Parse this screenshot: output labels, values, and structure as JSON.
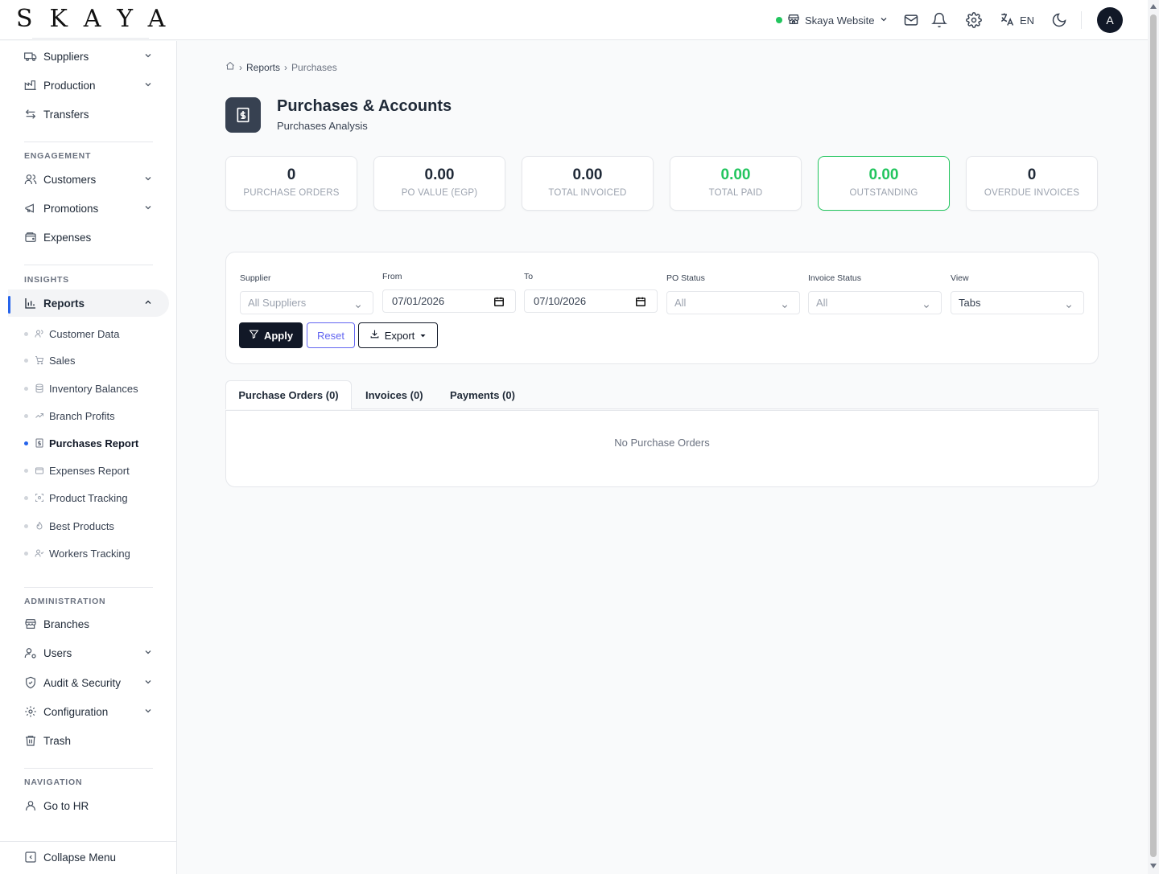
{
  "header": {
    "logo": "SKAYA",
    "store": "Skaya Website",
    "language": "EN",
    "avatar_initial": "A"
  },
  "sidebar": {
    "top_items": [
      {
        "label": "Suppliers"
      },
      {
        "label": "Production"
      },
      {
        "label": "Transfers"
      }
    ],
    "sections": {
      "engagement": "ENGAGEMENT",
      "insights": "INSIGHTS",
      "administration": "ADMINISTRATION",
      "navigation": "NAVIGATION"
    },
    "engagement_items": [
      {
        "label": "Customers"
      },
      {
        "label": "Promotions"
      },
      {
        "label": "Expenses"
      }
    ],
    "reports_label": "Reports",
    "report_subitems": [
      {
        "label": "Customer Data"
      },
      {
        "label": "Sales"
      },
      {
        "label": "Inventory Balances"
      },
      {
        "label": "Branch Profits"
      },
      {
        "label": "Purchases Report"
      },
      {
        "label": "Expenses Report"
      },
      {
        "label": "Product Tracking"
      },
      {
        "label": "Best Products"
      },
      {
        "label": "Workers Tracking"
      }
    ],
    "admin_items": [
      {
        "label": "Branches"
      },
      {
        "label": "Users"
      },
      {
        "label": "Audit & Security"
      },
      {
        "label": "Configuration"
      },
      {
        "label": "Trash"
      }
    ],
    "nav_items": [
      {
        "label": "Go to HR"
      }
    ],
    "collapse_label": "Collapse Menu"
  },
  "breadcrumb": {
    "parent": "Reports",
    "current": "Purchases"
  },
  "page": {
    "title": "Purchases & Accounts",
    "subtitle": "Purchases Analysis"
  },
  "stats": [
    {
      "value": "0",
      "label": "PURCHASE ORDERS"
    },
    {
      "value": "0.00",
      "label": "PO VALUE (EGP)"
    },
    {
      "value": "0.00",
      "label": "TOTAL INVOICED"
    },
    {
      "value": "0.00",
      "label": "TOTAL PAID"
    },
    {
      "value": "0.00",
      "label": "OUTSTANDING"
    },
    {
      "value": "0",
      "label": "OVERDUE INVOICES"
    }
  ],
  "filters": {
    "supplier_label": "Supplier",
    "supplier_value": "All Suppliers",
    "from_label": "From",
    "from_value": "07/01/2026",
    "to_label": "To",
    "to_value": "07/10/2026",
    "po_status_label": "PO Status",
    "po_status_value": "All",
    "invoice_status_label": "Invoice Status",
    "invoice_status_value": "All",
    "view_label": "View",
    "view_value": "Tabs",
    "apply": "Apply",
    "reset": "Reset",
    "export": "Export"
  },
  "tabs": [
    {
      "label": "Purchase Orders (0)"
    },
    {
      "label": "Invoices (0)"
    },
    {
      "label": "Payments (0)"
    }
  ],
  "empty_message": "No Purchase Orders",
  "colors": {
    "accent": "#2563eb",
    "green": "#22c55e",
    "dark": "#111827",
    "reset": "#6366f1"
  }
}
